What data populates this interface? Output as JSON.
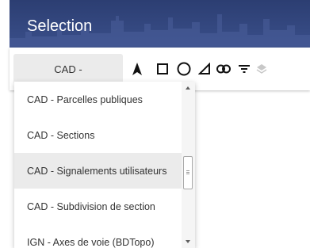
{
  "header": {
    "title": "Selection"
  },
  "toolbar": {
    "layer_select_value": "CAD -",
    "tools": [
      "pointer-icon",
      "rectangle-icon",
      "circle-icon",
      "polygon-icon",
      "link-icon",
      "filter-icon",
      "layers-icon"
    ]
  },
  "dropdown": {
    "options": [
      "CAD - Parcelles publiques",
      "CAD - Sections",
      "CAD - Signalements utilisateurs",
      "CAD - Subdivision de section",
      "IGN - Axes de voie (BDTopo)"
    ],
    "highlighted_option": "CAD - Signalements utilisateurs"
  },
  "colors": {
    "header": "#2c3e72",
    "toolbar_bg": "#ffffff",
    "select_bg": "#ebebeb",
    "highlight": "#ebebeb"
  }
}
